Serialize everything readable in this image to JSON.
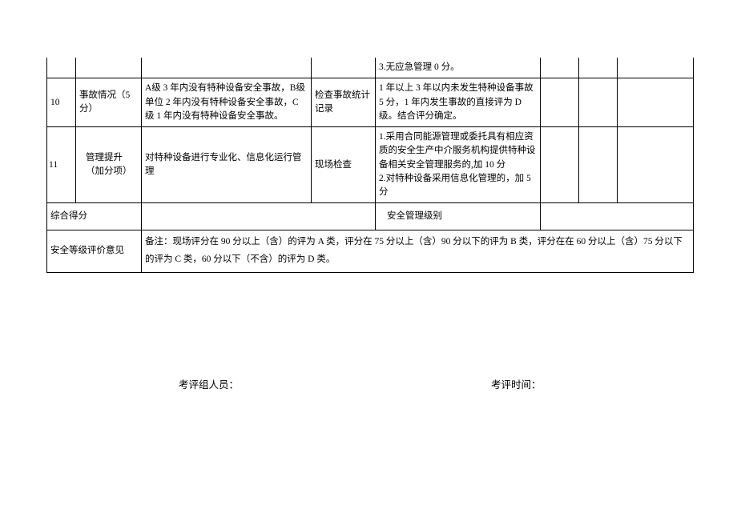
{
  "rows": [
    {
      "num": "",
      "name": "",
      "criteria": "",
      "check": "",
      "scoring": "3.无应急管理 0 分。"
    },
    {
      "num": "10",
      "name": "事故情况（5分）",
      "criteria": "A级 3 年内没有特种设备安全事故，B级单位 2 年内没有特种设备安全事故，C级 1 年内没有特种设备安全事故。",
      "check": "检查事故统计记录",
      "scoring": "1 年以上 3 年以内未发生特种设备事故 5 分，1 年内发生事故的直接评为 D 级。结合评分确定。"
    },
    {
      "num": "11",
      "name": "管理提升（加分项）",
      "criteria": "对特种设备进行专业化、信息化运行管理",
      "check": "现场检查",
      "scoring": "1.采用合同能源管理或委托具有相应资质的安全生产中介服务机构提供特种设备相关安全管理服务的,加 10 分\n2.对特种设备采用信息化管理的，加 5 分"
    }
  ],
  "summary": {
    "score_label": "综合得分",
    "level_label": "安全管理级别",
    "opinion_label": "安全等级评价意见",
    "note": "备注：现场评分在 90 分以上（含）的评为 A 类，评分在 75 分以上（含）90 分以下的评为 B 类，评分在在 60 分以上（含）75 分以下的评为 C 类，60 分以下（不含）的评为 D 类。"
  },
  "footer": {
    "evaluator_label": "考评组人员：",
    "time_label": "考评时间："
  }
}
